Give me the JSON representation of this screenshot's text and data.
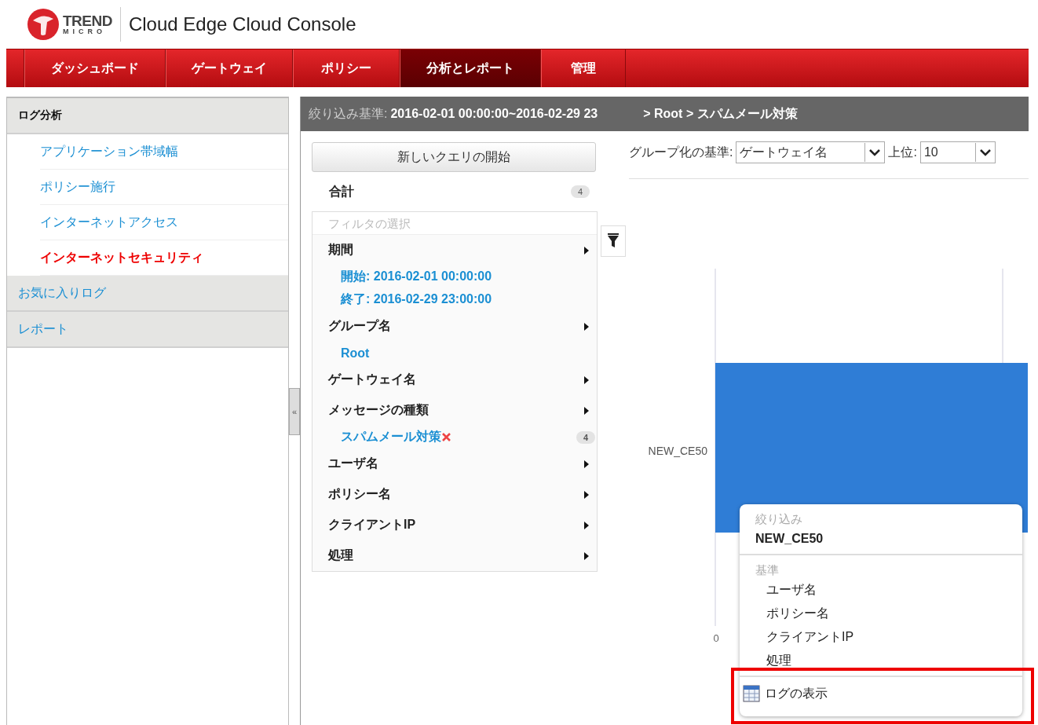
{
  "header": {
    "logo": {
      "line1": "TREND",
      "line2": "MICRO"
    },
    "title": "Cloud Edge Cloud Console"
  },
  "nav": [
    {
      "label": "ダッシュボード",
      "selected": false
    },
    {
      "label": "ゲートウェイ",
      "selected": false
    },
    {
      "label": "ポリシー",
      "selected": false
    },
    {
      "label": "分析とレポート",
      "selected": true
    },
    {
      "label": "管理",
      "selected": false
    }
  ],
  "sidebar": {
    "sections": [
      {
        "label": "ログ分析",
        "expanded": true,
        "children": [
          {
            "label": "アプリケーション帯域幅",
            "selected": false
          },
          {
            "label": "ポリシー施行",
            "selected": false
          },
          {
            "label": "インターネットアクセス",
            "selected": false
          },
          {
            "label": "インターネットセキュリティ",
            "selected": true
          }
        ]
      },
      {
        "label": "お気に入りログ",
        "expanded": false
      },
      {
        "label": "レポート",
        "expanded": false
      }
    ]
  },
  "collapse_handle": "«",
  "filter_bar": {
    "label": "絞り込み基準:",
    "range": "2016-02-01 00:00:00~2016-02-29 23",
    "breadcrumb": "> Root > スパムメール対策"
  },
  "new_query_button": "新しいクエリの開始",
  "total": {
    "label": "合計",
    "count": "4"
  },
  "filter_select": {
    "placeholder": "フィルタの選択"
  },
  "filters": [
    {
      "label": "期間",
      "values": [
        {
          "text": "開始: 2016-02-01 00:00:00"
        },
        {
          "text": "終了: 2016-02-29 23:00:00"
        }
      ]
    },
    {
      "label": "グループ名",
      "values": [
        {
          "text": "Root"
        }
      ]
    },
    {
      "label": "ゲートウェイ名"
    },
    {
      "label": "メッセージの種類",
      "values": [
        {
          "text": "スパムメール対策",
          "removable": true,
          "count": "4"
        }
      ]
    },
    {
      "label": "ユーザ名"
    },
    {
      "label": "ポリシー名"
    },
    {
      "label": "クライアントIP"
    },
    {
      "label": "処理"
    }
  ],
  "group_by": {
    "label": "グループ化の基準:",
    "value": "ゲートウェイ名"
  },
  "top": {
    "label": "上位:",
    "value": "10"
  },
  "chart": {
    "category": "NEW_CE50",
    "tick": "0"
  },
  "context_menu": {
    "filter_heading": "絞り込み",
    "filter_value": "NEW_CE50",
    "criteria_heading": "基準",
    "criteria": [
      "ユーザ名",
      "ポリシー名",
      "クライアントIP",
      "処理"
    ],
    "action": "ログの表示",
    "highlighted": true
  }
}
